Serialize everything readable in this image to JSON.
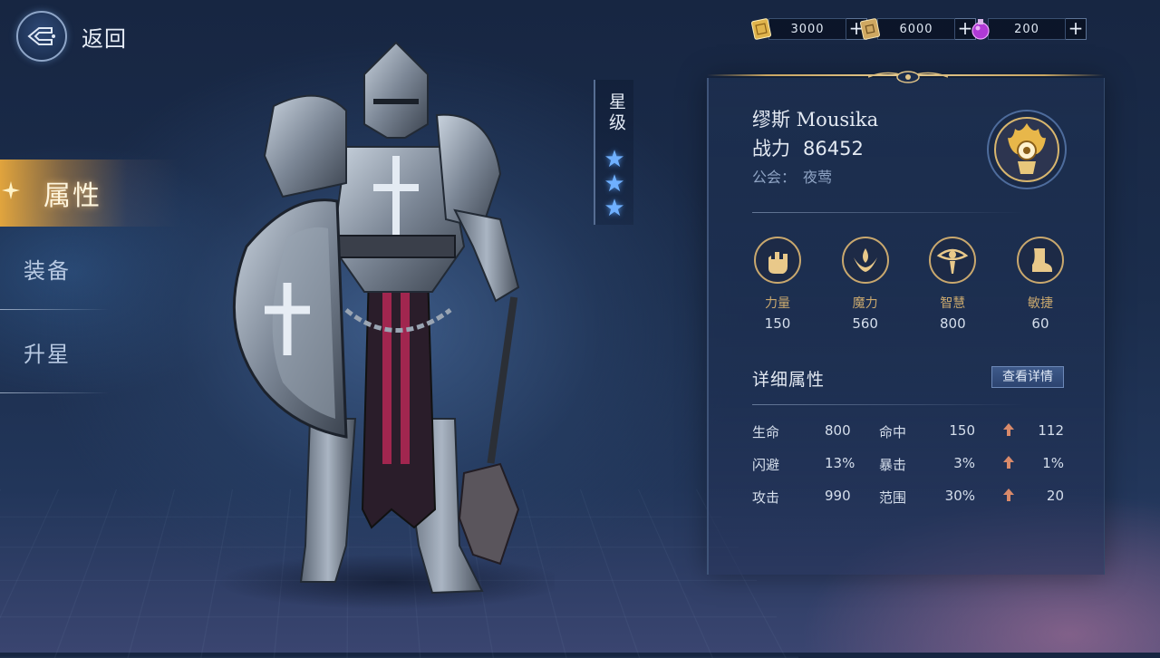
{
  "header": {
    "back_label": "返回"
  },
  "currencies": [
    {
      "icon": "gold-ticket-icon",
      "value": "3000"
    },
    {
      "icon": "silver-ticket-icon",
      "value": "6000"
    },
    {
      "icon": "purple-potion-icon",
      "value": "200"
    }
  ],
  "nav": {
    "items": [
      {
        "label": "属性",
        "active": true
      },
      {
        "label": "装备",
        "active": false
      },
      {
        "label": "升星",
        "active": false
      }
    ]
  },
  "rank": {
    "title": "星级",
    "stars": 3
  },
  "hero": {
    "name": "缪斯 Mousika",
    "power_label": "战力",
    "power_value": "86452",
    "guild_label": "公会：",
    "guild_value": "夜莺"
  },
  "attributes": [
    {
      "name": "力量",
      "value": "150",
      "icon": "fist-icon"
    },
    {
      "name": "魔力",
      "value": "560",
      "icon": "magic-flame-icon"
    },
    {
      "name": "智慧",
      "value": "800",
      "icon": "eye-icon"
    },
    {
      "name": "敏捷",
      "value": "60",
      "icon": "boot-icon"
    }
  ],
  "detail": {
    "title": "详细属性",
    "button_label": "查看详情",
    "rows": [
      {
        "l1": "生命",
        "v1": "800",
        "l2": "命中",
        "v2": "150",
        "v3": "112"
      },
      {
        "l1": "闪避",
        "v1": "13%",
        "l2": "暴击",
        "v2": "3%",
        "v3": "1%"
      },
      {
        "l1": "攻击",
        "v1": "990",
        "l2": "范围",
        "v2": "30%",
        "v3": "20"
      }
    ]
  },
  "colors": {
    "accent_gold": "#c9a86e",
    "star_blue": "#6fb0ff",
    "active_tab": "#e9aa3c"
  }
}
